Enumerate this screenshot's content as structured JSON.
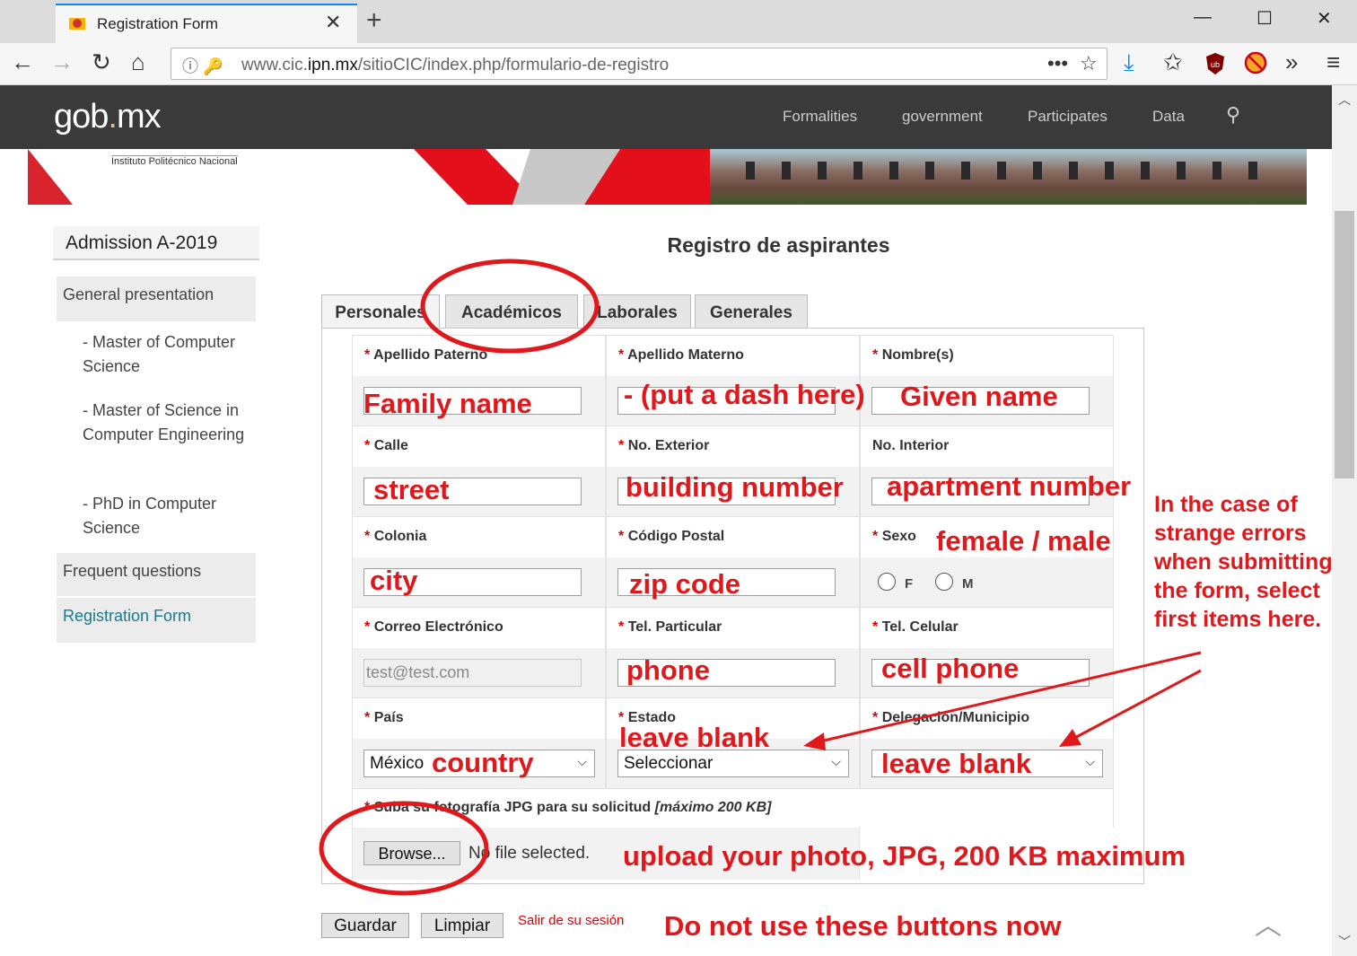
{
  "browser": {
    "tab_title": "Registration Form",
    "url_host_pre": "www.cic.",
    "url_host_main": "ipn.mx",
    "url_path": "/sitioCIC/index.php/formulario-de-registro"
  },
  "site_header": {
    "logo_main": "gob",
    "logo_dot": ".",
    "logo_end": "mx",
    "nav": [
      "Formalities",
      "government",
      "Participates",
      "Data"
    ]
  },
  "banner": {
    "institution": "Instituto Politécnico Nacional"
  },
  "sidebar": {
    "title": "Admission A-2019",
    "general": "General presentation",
    "programs": [
      "- Master of Computer Science",
      "- Master of Science in Computer Engineering",
      "- PhD in Computer Science"
    ],
    "faq": "Frequent questions",
    "registration": "Registration Form"
  },
  "form": {
    "title": "Registro de aspirantes",
    "tabs": [
      "Personales",
      "Académicos",
      "Laborales",
      "Generales"
    ],
    "required_mark": "*",
    "labels": {
      "apellido_paterno": "Apellido Paterno",
      "apellido_materno": "Apellido Materno",
      "nombre": "Nombre(s)",
      "calle": "Calle",
      "no_exterior": "No. Exterior",
      "no_interior": "No. Interior",
      "colonia": "Colonia",
      "codigo_postal": "Código Postal",
      "sexo": "Sexo",
      "correo": "Correo Electrónico",
      "tel_particular": "Tel. Particular",
      "tel_celular": "Tel. Celular",
      "pais": "País",
      "estado": "Estado",
      "delegacion": "Delegación/Municipio",
      "foto": "Suba su fotografía JPG para su solicitud",
      "foto_max": "[máximo 200 KB]"
    },
    "email_placeholder": "test@test.com",
    "sex_options": [
      "F",
      "M"
    ],
    "pais_value": "México",
    "estado_value": "Seleccionar",
    "browse_label": "Browse...",
    "no_file": "No file selected.",
    "save_label": "Guardar",
    "clear_label": "Limpiar",
    "logout_label": "Salir de su sesión"
  },
  "annotations": {
    "family_name": "Family name",
    "dash": "- (put a dash here)",
    "given_name": "Given name",
    "street": "street",
    "building": "building number",
    "apartment": "apartment number",
    "sex": "female / male",
    "city": "city",
    "zip": "zip code",
    "phone": "phone",
    "cell": "cell phone",
    "country": "country",
    "leave_blank_1": "leave blank",
    "leave_blank_2": "leave blank",
    "note": "In the case of strange errors when submitting the form, select first items here.",
    "upload": "upload your photo, JPG, 200 KB maximum",
    "buttons": "Do not use these buttons now"
  },
  "colors": {
    "annotation": "#e0181c",
    "header_bg": "#3a3a3a",
    "accent_link": "#1a7a8a"
  }
}
